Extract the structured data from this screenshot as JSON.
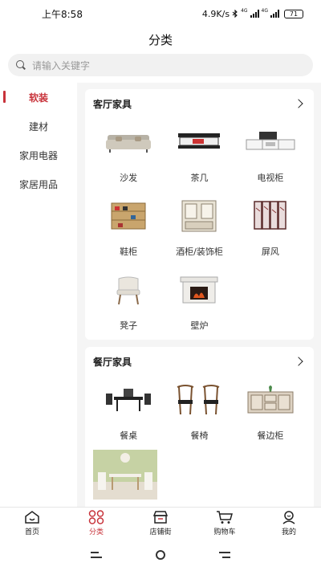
{
  "status": {
    "time": "上午8:58",
    "speed": "4.9K/s",
    "net1": "4G",
    "net2": "4G",
    "battery": "71"
  },
  "header": {
    "title": "分类"
  },
  "search": {
    "placeholder": "请输入关键字"
  },
  "sidebar": {
    "items": [
      {
        "label": "软装",
        "active": true
      },
      {
        "label": "建材"
      },
      {
        "label": "家用电器"
      },
      {
        "label": "家居用品"
      }
    ]
  },
  "sections": [
    {
      "title": "客厅家具",
      "items": [
        {
          "label": "沙发",
          "icon": "sofa-icon"
        },
        {
          "label": "茶几",
          "icon": "coffee-table-icon"
        },
        {
          "label": "电视柜",
          "icon": "tv-cabinet-icon"
        },
        {
          "label": "鞋柜",
          "icon": "shoe-cabinet-icon"
        },
        {
          "label": "酒柜/装饰柜",
          "icon": "wine-cabinet-icon"
        },
        {
          "label": "屏风",
          "icon": "screen-icon"
        },
        {
          "label": "凳子",
          "icon": "stool-icon"
        },
        {
          "label": "壁炉",
          "icon": "fireplace-icon"
        }
      ]
    },
    {
      "title": "餐厅家具",
      "items": [
        {
          "label": "餐桌",
          "icon": "dining-table-icon"
        },
        {
          "label": "餐椅",
          "icon": "dining-chair-icon"
        },
        {
          "label": "餐边柜",
          "icon": "sideboard-icon"
        },
        {
          "label": "",
          "icon": "dining-room-photo"
        }
      ]
    }
  ],
  "tabbar": {
    "items": [
      {
        "label": "首页",
        "icon": "home-icon"
      },
      {
        "label": "分类",
        "icon": "category-icon",
        "active": true
      },
      {
        "label": "店铺街",
        "icon": "store-icon"
      },
      {
        "label": "购物车",
        "icon": "cart-icon"
      },
      {
        "label": "我的",
        "icon": "profile-icon"
      }
    ]
  },
  "colors": {
    "accent": "#c8323a",
    "content_bg": "#f5f5f5"
  }
}
